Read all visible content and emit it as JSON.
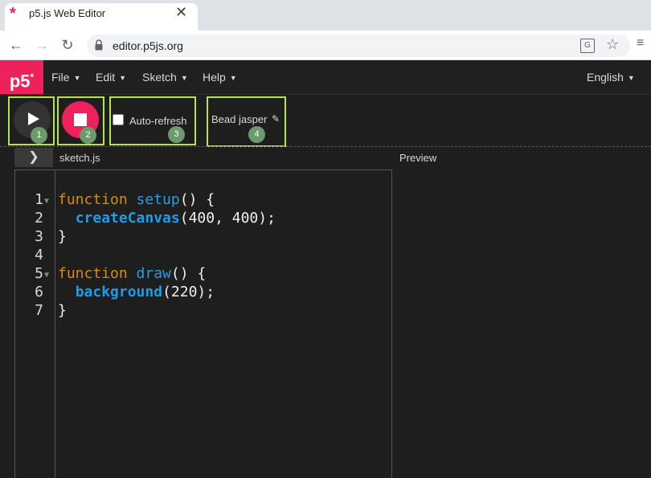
{
  "browser": {
    "tab_title": "p5.js Web Editor",
    "tab_icon": "p5-asterisk-icon",
    "close_glyph": "✕",
    "url": "editor.p5js.org",
    "nav_back": "←",
    "nav_forward": "→",
    "nav_reload": "↻"
  },
  "p5": {
    "logo": "p5",
    "logo_mark": "*",
    "menus": [
      "File",
      "Edit",
      "Sketch",
      "Help"
    ],
    "language": "English",
    "accent": "#ed225d"
  },
  "controls": {
    "auto_refresh_label": "Auto-refresh",
    "auto_refresh_checked": false,
    "sketch_name": "Bead jasper",
    "badges": [
      "1",
      "2",
      "3",
      "4"
    ],
    "highlight_color": "#b7e34b"
  },
  "editor": {
    "toggle_glyph": "❯",
    "file_name": "sketch.js",
    "preview_label": "Preview",
    "lines": [
      {
        "num": "1",
        "fold": true
      },
      {
        "num": "2",
        "fold": false
      },
      {
        "num": "3",
        "fold": false
      },
      {
        "num": "4",
        "fold": false
      },
      {
        "num": "5",
        "fold": true
      },
      {
        "num": "6",
        "fold": false
      },
      {
        "num": "7",
        "fold": false
      }
    ],
    "code": {
      "l1_kw": "function",
      "l1_fn": "setup",
      "l1_rest": "() {",
      "l2_fn": "createCanvas",
      "l2_rest": "(400, 400);",
      "l3": "}",
      "l5_kw": "function",
      "l5_fn": "draw",
      "l5_rest": "() {",
      "l6_fn": "background",
      "l6_rest": "(220);",
      "l7": "}"
    }
  }
}
